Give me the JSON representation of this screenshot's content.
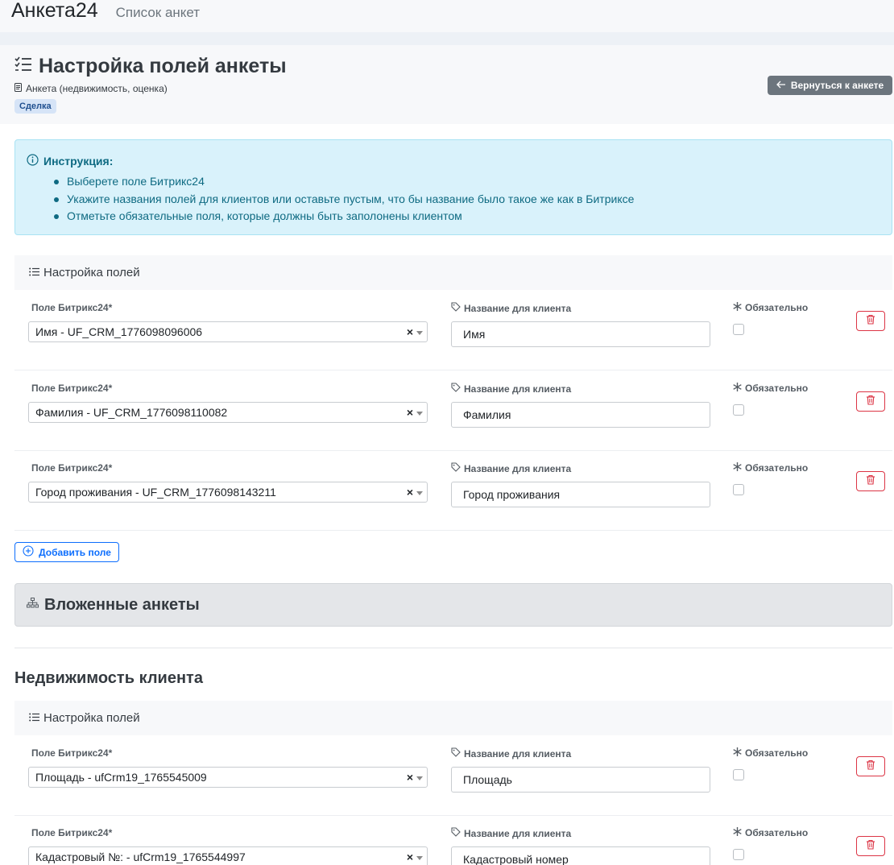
{
  "navbar": {
    "brand": "Анкета24",
    "link": "Список анкет"
  },
  "header": {
    "title": "Настройка полей анкеты",
    "subtitle": "Анкета (недвижимость, оценка)",
    "badge": "Сделка",
    "back_button": "Вернуться к анкете"
  },
  "instructions": {
    "title": "Инструкция:",
    "items": [
      "Выберете поле Битрикс24",
      "Укажите названия полей для клиентов или оставьте пустым, что бы название было такое же как в Битриксе",
      "Отметьте обязательные поля, которые должны быть заполонены клиентом"
    ]
  },
  "labels": {
    "bitrix_field": "Поле Битрикс24*",
    "client_name": "Название для клиента",
    "required": "Обязательно"
  },
  "main_section": {
    "title": "Настройка полей",
    "fields": [
      {
        "bitrix_field": "Имя - UF_CRM_1776098096006",
        "client_name": "Имя",
        "required": false
      },
      {
        "bitrix_field": "Фамилия - UF_CRM_1776098110082",
        "client_name": "Фамилия",
        "required": false
      },
      {
        "bitrix_field": "Город проживания - UF_CRM_1776098143211",
        "client_name": "Город проживания",
        "required": false
      }
    ],
    "add_button": "Добавить поле"
  },
  "nested": {
    "title": "Вложенные анкеты",
    "subform_title": "Недвижимость клиента",
    "section_title": "Настройка полей",
    "fields": [
      {
        "bitrix_field": "Площадь - ufCrm19_1765545009",
        "client_name": "Площадь",
        "required": false
      },
      {
        "bitrix_field": "Кадастровый №: - ufCrm19_1765544997",
        "client_name": "Кадастровый номер",
        "required": false
      }
    ]
  },
  "colors": {
    "info_bg": "#d9f2fb",
    "info_text": "#0e6a82",
    "primary": "#0d6efd",
    "danger": "#dc3545",
    "secondary": "#6c757d"
  }
}
